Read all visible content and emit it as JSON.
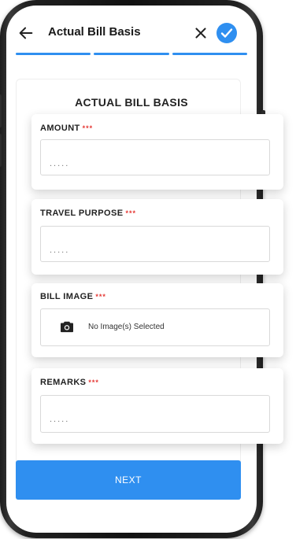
{
  "header": {
    "title": "Actual Bill Basis",
    "back_icon": "arrow-left-icon",
    "close_icon": "close-icon",
    "confirm_icon": "check-circle-icon"
  },
  "progress": {
    "steps": 3,
    "completed": 3
  },
  "section": {
    "title": "ACTUAL BILL BASIS"
  },
  "fields": {
    "amount": {
      "label": "AMOUNT",
      "required_mark": "***",
      "placeholder": "....."
    },
    "travel_purpose": {
      "label": "TRAVEL PURPOSE",
      "required_mark": "***",
      "placeholder": "....."
    },
    "bill_image": {
      "label": "BILL IMAGE",
      "required_mark": "***",
      "status": "No Image(s) Selected",
      "icon": "camera-icon"
    },
    "remarks": {
      "label": "REMARKS",
      "required_mark": "***",
      "placeholder": "....."
    }
  },
  "footer": {
    "next_label": "NEXT"
  },
  "colors": {
    "accent": "#2f8ff0",
    "required": "#e53935"
  }
}
